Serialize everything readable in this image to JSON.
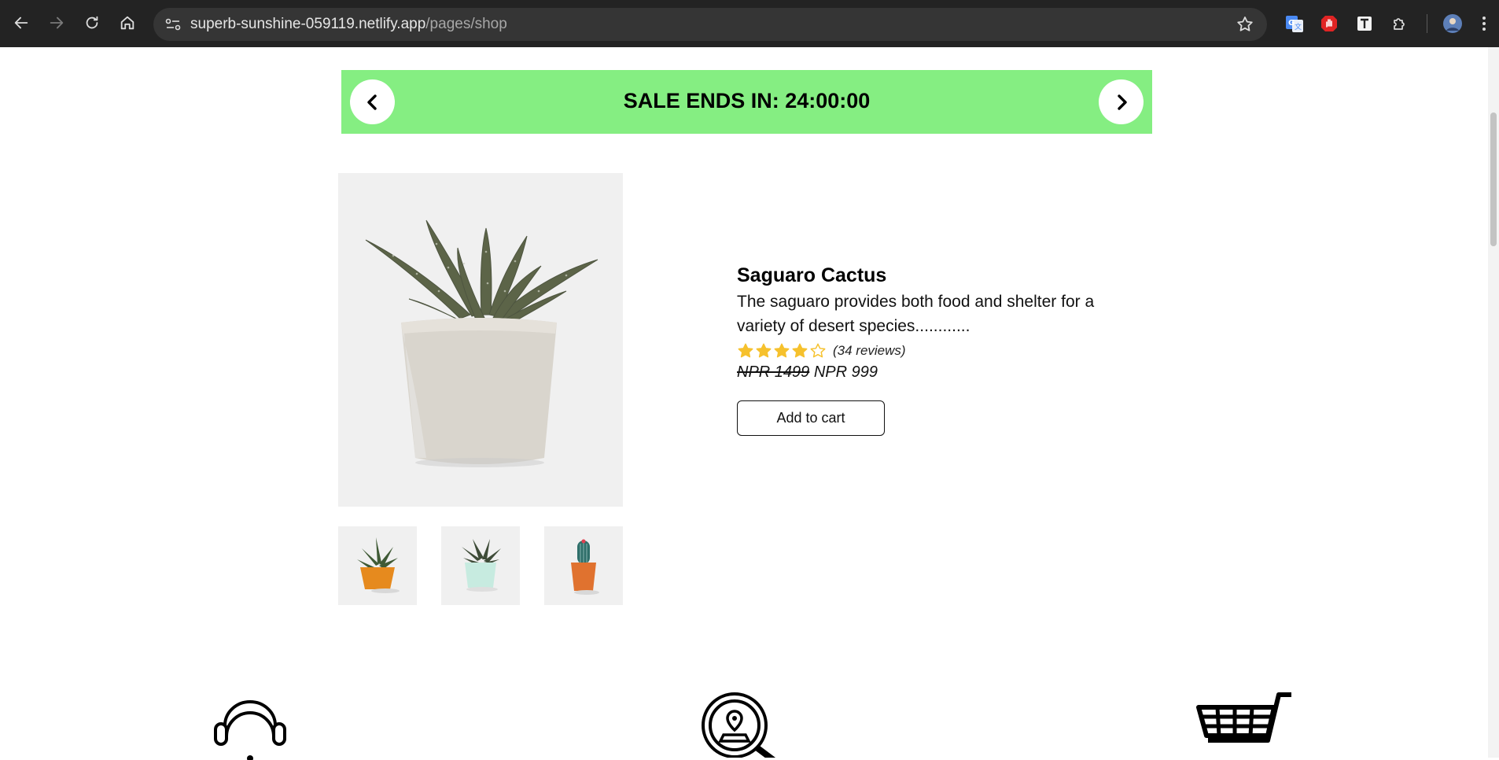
{
  "browser": {
    "url_host": "superb-sunshine-059119.netlify.app",
    "url_path": "/pages/shop"
  },
  "sale_banner": {
    "text": "SALE ENDS IN: 24:00:00"
  },
  "product": {
    "title": "Saguaro Cactus",
    "description": "The saguaro provides both food and shelter for a variety of desert species............",
    "rating": 4,
    "rating_max": 5,
    "reviews_label": "(34 reviews)",
    "old_price": "NPR 1499",
    "price": "NPR 999",
    "add_to_cart_label": "Add to cart",
    "star_color": "#f6c12d"
  },
  "colors": {
    "banner": "#85ee82",
    "chrome": "#232323"
  }
}
